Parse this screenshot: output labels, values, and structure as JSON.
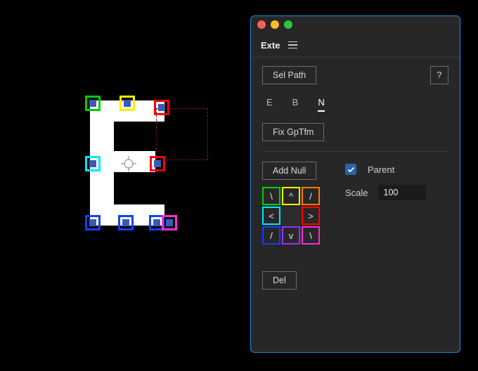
{
  "panel": {
    "title": "Exte",
    "sel_path_label": "Sel Path",
    "help_label": "?",
    "tabs": {
      "e": "E",
      "b": "B",
      "n": "N",
      "active": "n"
    },
    "fix_gptfm_label": "Fix GpTfm",
    "add_null_label": "Add Null",
    "parent_label": "Parent",
    "parent_checked": true,
    "scale_label": "Scale",
    "scale_value": "100",
    "del_label": "Del",
    "dir_glyphs": {
      "tl": "\\",
      "t": "^",
      "tr": "/",
      "l": "<",
      "r": ">",
      "bl": "/",
      "b": "v",
      "br": "\\"
    }
  },
  "nulls": {
    "colors": {
      "tl": "#00d000",
      "t": "#ffee00",
      "tr": "#ff0000",
      "l": "#00e5ff",
      "r": "#ff0000",
      "bl": "#1040ff",
      "b": "#1040ff",
      "br2": "#1040ff",
      "br_pink": "#ff2bd6"
    }
  }
}
